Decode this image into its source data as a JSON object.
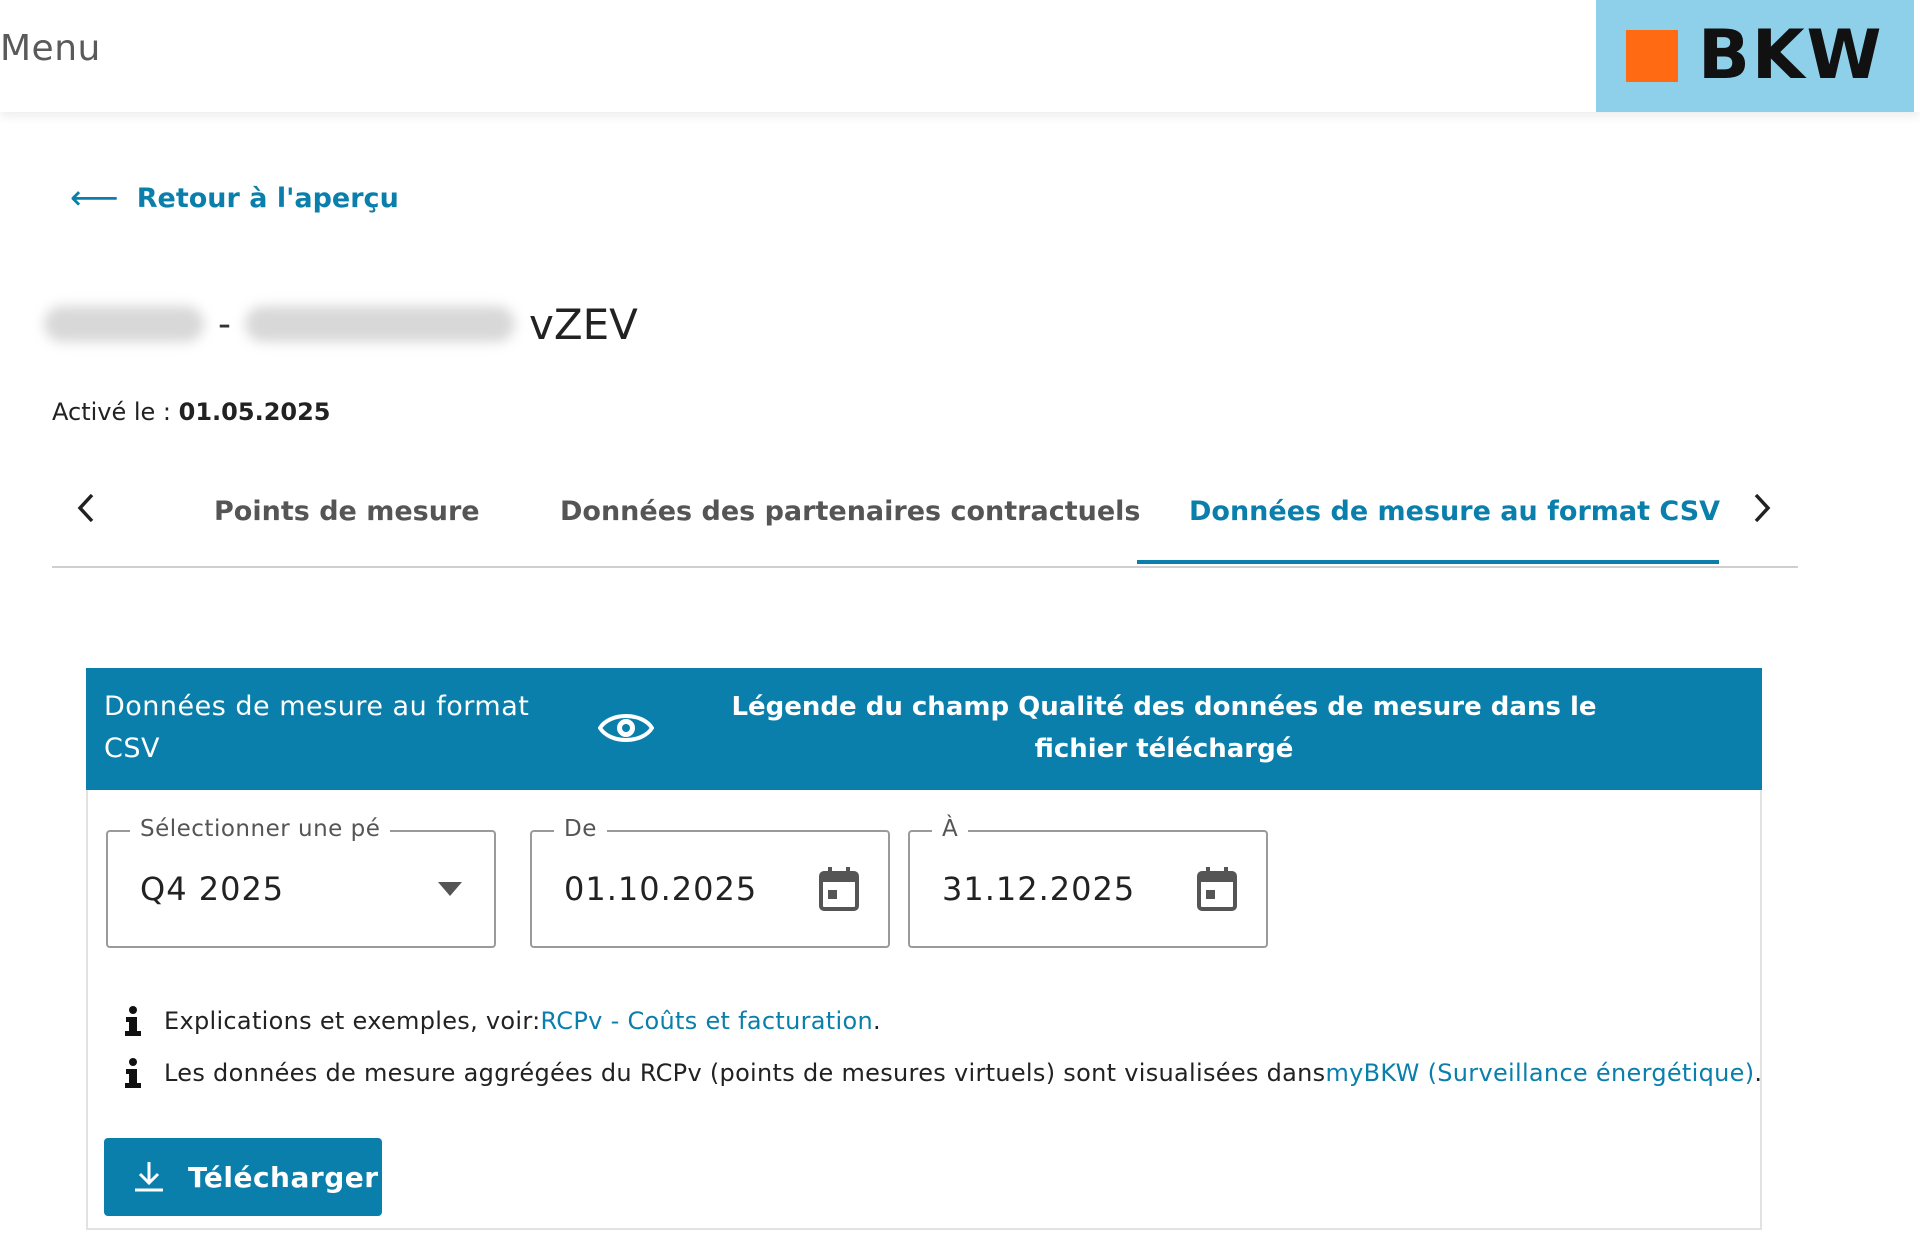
{
  "header": {
    "menu_label": "Menu",
    "logo_text": "BKW"
  },
  "colors": {
    "accent": "#0a7fab",
    "logo_bg": "#8ed0ea",
    "logo_square": "#ff6a13"
  },
  "back_link": {
    "label": "Retour à l'aperçu"
  },
  "title": {
    "separator": "-",
    "suffix": "vZEV"
  },
  "activation": {
    "label": "Activé le :",
    "date": "01.05.2025"
  },
  "tabs": [
    {
      "label": "Points de mesure",
      "active": false
    },
    {
      "label": "Données des partenaires contractuels",
      "active": false
    },
    {
      "label": "Données de mesure au format CSV",
      "active": true
    }
  ],
  "card": {
    "title": "Données de mesure au format CSV",
    "legend_link": "Légende du champ Qualité des données de mesure dans le fichier téléchargé"
  },
  "period_field": {
    "label": "Sélectionner une pé",
    "value": "Q4 2025"
  },
  "from_field": {
    "label": "De",
    "value": "01.10.2025"
  },
  "to_field": {
    "label": "À",
    "value": "31.12.2025"
  },
  "info": [
    {
      "text": "Explications et exemples, voir: ",
      "link": "RCPv - Coûts et facturation",
      "after": "."
    },
    {
      "text": "Les données de mesure aggrégées du RCPv (points de mesures virtuels) sont visualisées dans ",
      "link": "myBKW (Surveillance énergétique)",
      "after": "."
    }
  ],
  "download_button": {
    "label": "Télécharger"
  }
}
